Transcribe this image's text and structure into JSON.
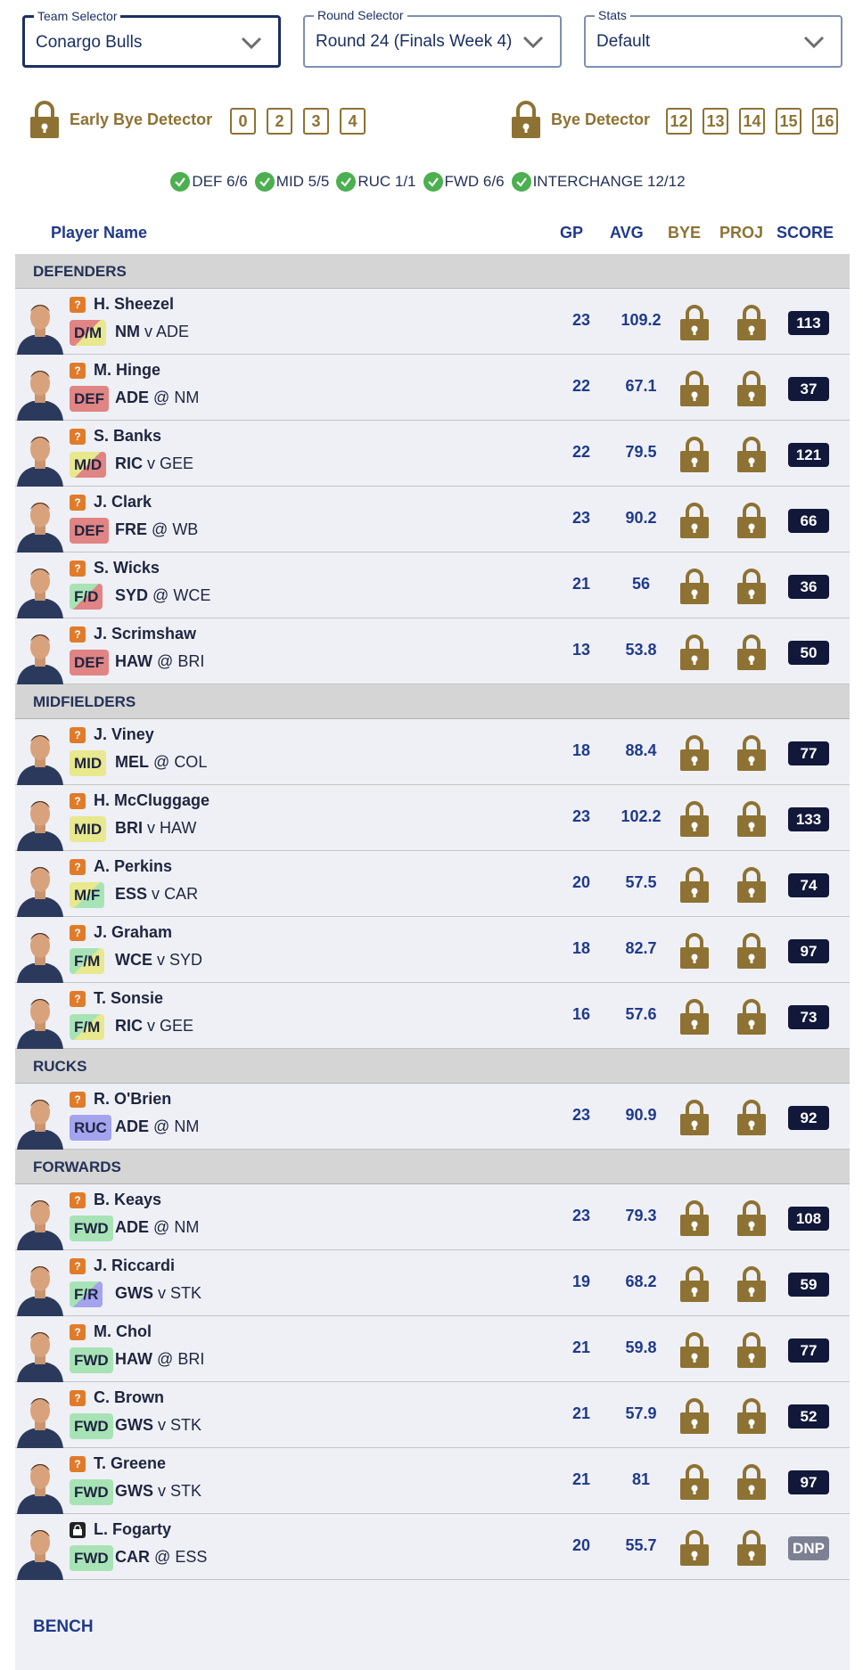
{
  "selectors": [
    {
      "label": "Team Selector",
      "value": "Conargo Bulls"
    },
    {
      "label": "Round Selector",
      "value": "Round 24 (Finals Week 4)"
    },
    {
      "label": "Stats",
      "value": "Default"
    }
  ],
  "early_bye": {
    "title": "Early Bye Detector",
    "rounds": [
      "0",
      "2",
      "3",
      "4"
    ]
  },
  "bye": {
    "title": "Bye Detector",
    "rounds": [
      "12",
      "13",
      "14",
      "15",
      "16"
    ]
  },
  "counts": [
    "DEF 6/6",
    "MID 5/5",
    "RUC 1/1",
    "FWD 6/6",
    "INTERCHANGE 12/12"
  ],
  "headers": {
    "player": "Player Name",
    "gp": "GP",
    "avg": "AVG",
    "bye": "BYE",
    "proj": "PROJ",
    "score": "SCORE"
  },
  "colors": {
    "def": "#e08484",
    "mid": "#e8e88e",
    "ruc": "#a3a3ee",
    "fwd": "#a8e3b6",
    "gold": "#8d7233",
    "navy": "#1f3a8a"
  },
  "sections": [
    {
      "title": "DEFENDERS",
      "players": [
        {
          "name": "H. Sheezel",
          "pos": "D/M",
          "team": "NM",
          "sep": "v",
          "opp": "ADE",
          "gp": "23",
          "avg": "109.2",
          "score": "113",
          "status": "?"
        },
        {
          "name": "M. Hinge",
          "pos": "DEF",
          "team": "ADE",
          "sep": "@",
          "opp": "NM",
          "gp": "22",
          "avg": "67.1",
          "score": "37",
          "status": "?"
        },
        {
          "name": "S. Banks",
          "pos": "M/D",
          "team": "RIC",
          "sep": "v",
          "opp": "GEE",
          "gp": "22",
          "avg": "79.5",
          "score": "121",
          "status": "?"
        },
        {
          "name": "J. Clark",
          "pos": "DEF",
          "team": "FRE",
          "sep": "@",
          "opp": "WB",
          "gp": "23",
          "avg": "90.2",
          "score": "66",
          "status": "?"
        },
        {
          "name": "S. Wicks",
          "pos": "F/D",
          "team": "SYD",
          "sep": "@",
          "opp": "WCE",
          "gp": "21",
          "avg": "56",
          "score": "36",
          "status": "?"
        },
        {
          "name": "J. Scrimshaw",
          "pos": "DEF",
          "team": "HAW",
          "sep": "@",
          "opp": "BRI",
          "gp": "13",
          "avg": "53.8",
          "score": "50",
          "status": "?"
        }
      ]
    },
    {
      "title": "MIDFIELDERS",
      "players": [
        {
          "name": "J. Viney",
          "pos": "MID",
          "team": "MEL",
          "sep": "@",
          "opp": "COL",
          "gp": "18",
          "avg": "88.4",
          "score": "77",
          "status": "?"
        },
        {
          "name": "H. McCluggage",
          "pos": "MID",
          "team": "BRI",
          "sep": "v",
          "opp": "HAW",
          "gp": "23",
          "avg": "102.2",
          "score": "133",
          "status": "?"
        },
        {
          "name": "A. Perkins",
          "pos": "M/F",
          "team": "ESS",
          "sep": "v",
          "opp": "CAR",
          "gp": "20",
          "avg": "57.5",
          "score": "74",
          "status": "?"
        },
        {
          "name": "J. Graham",
          "pos": "F/M",
          "team": "WCE",
          "sep": "v",
          "opp": "SYD",
          "gp": "18",
          "avg": "82.7",
          "score": "97",
          "status": "?"
        },
        {
          "name": "T. Sonsie",
          "pos": "F/M",
          "team": "RIC",
          "sep": "v",
          "opp": "GEE",
          "gp": "16",
          "avg": "57.6",
          "score": "73",
          "status": "?"
        }
      ]
    },
    {
      "title": "RUCKS",
      "players": [
        {
          "name": "R. O'Brien",
          "pos": "RUC",
          "team": "ADE",
          "sep": "@",
          "opp": "NM",
          "gp": "23",
          "avg": "90.9",
          "score": "92",
          "status": "?"
        }
      ]
    },
    {
      "title": "FORWARDS",
      "players": [
        {
          "name": "B. Keays",
          "pos": "FWD",
          "team": "ADE",
          "sep": "@",
          "opp": "NM",
          "gp": "23",
          "avg": "79.3",
          "score": "108",
          "status": "?"
        },
        {
          "name": "J. Riccardi",
          "pos": "F/R",
          "team": "GWS",
          "sep": "v",
          "opp": "STK",
          "gp": "19",
          "avg": "68.2",
          "score": "59",
          "status": "?"
        },
        {
          "name": "M. Chol",
          "pos": "FWD",
          "team": "HAW",
          "sep": "@",
          "opp": "BRI",
          "gp": "21",
          "avg": "59.8",
          "score": "77",
          "status": "?"
        },
        {
          "name": "C. Brown",
          "pos": "FWD",
          "team": "GWS",
          "sep": "v",
          "opp": "STK",
          "gp": "21",
          "avg": "57.9",
          "score": "52",
          "status": "?"
        },
        {
          "name": "T. Greene",
          "pos": "FWD",
          "team": "GWS",
          "sep": "v",
          "opp": "STK",
          "gp": "21",
          "avg": "81",
          "score": "97",
          "status": "?"
        },
        {
          "name": "L. Fogarty",
          "pos": "FWD",
          "team": "CAR",
          "sep": "@",
          "opp": "ESS",
          "gp": "20",
          "avg": "55.7",
          "score": "DNP",
          "status": "lock"
        }
      ]
    }
  ],
  "bench": {
    "title": "BENCH"
  }
}
